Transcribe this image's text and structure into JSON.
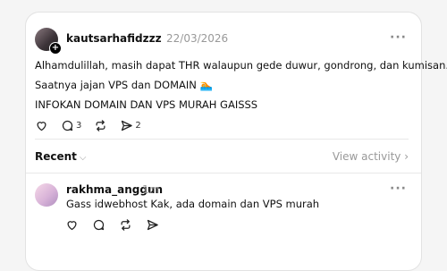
{
  "top_hint": "···",
  "post": {
    "username": "kautsarhafidzzz",
    "timestamp": "22/03/2026",
    "more": "···",
    "lines": [
      "Alhamdulillah, masih dapat THR walaupun gede duwur, gondrong, dan kumisan.",
      "Saatnya jajan VPS dan DOMAIN 🏊",
      "INFOKAN DOMAIN DAN VPS MURAH GAISSS"
    ],
    "reply_count": "3",
    "share_count": "2"
  },
  "replies_bar": {
    "sort_label": "Recent",
    "sort_chevron": "⌵",
    "view_activity": "View activity ›"
  },
  "reply": {
    "username": "rakhma_anggun",
    "timestamp": "1m",
    "more": "···",
    "text": "Gass idwebhost Kak, ada domain dan VPS murah"
  },
  "icons": {
    "like": "heart-icon",
    "comment": "comment-icon",
    "repost": "repost-icon",
    "share": "share-icon"
  }
}
